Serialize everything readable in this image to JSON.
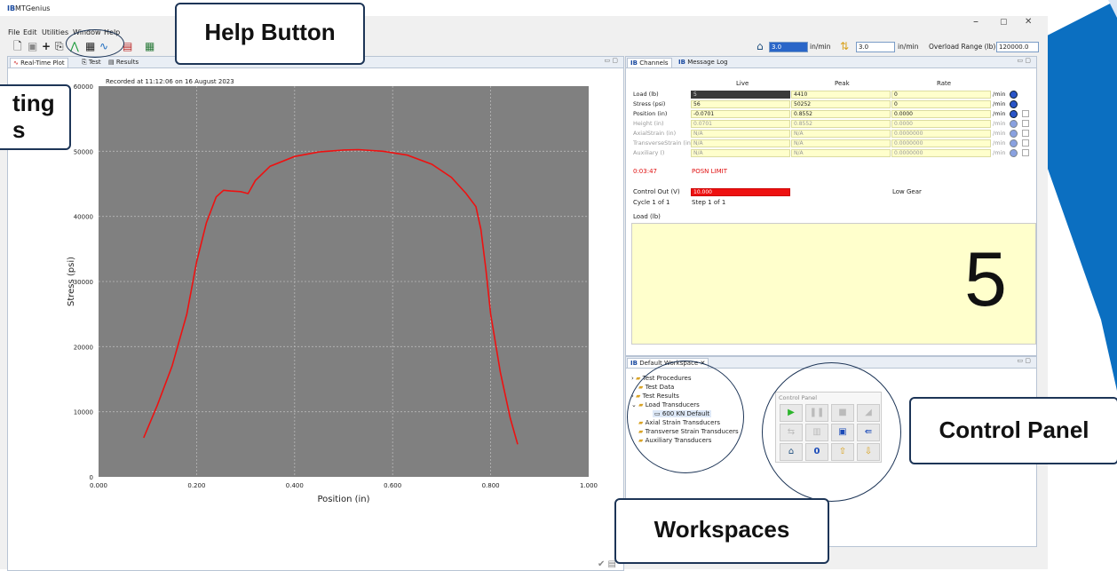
{
  "window": {
    "app_name": "MTGenius",
    "logo": "IB",
    "min_btn": "–",
    "max_btn": "▢",
    "close_btn": "✕"
  },
  "menu": [
    "File",
    "Edit",
    "Utilities",
    "Window",
    "Help"
  ],
  "toolbar": {
    "rate1_value": "3.0",
    "rate1_unit": "in/min",
    "rate2_value": "3.0",
    "rate2_unit": "in/min",
    "overload_label": "Overload Range (lb):",
    "overload_value": "120000.0"
  },
  "left_tabs": [
    "Real-Time Plot",
    "Test",
    "Results"
  ],
  "plot": {
    "recorded": "Recorded at 11:12:06 on 16 August 2023",
    "xlabel": "Position (in)",
    "ylabel": "Stress (psi)",
    "xticks": [
      "0.000",
      "0.200",
      "0.400",
      "0.600",
      "0.800",
      "1.000"
    ],
    "yticks": [
      "0",
      "10000",
      "20000",
      "30000",
      "40000",
      "50000",
      "60000"
    ]
  },
  "chart_data": {
    "type": "line",
    "title": "Recorded at 11:12:06 on 16 August 2023",
    "xlabel": "Position (in)",
    "ylabel": "Stress (psi)",
    "xlim": [
      0,
      1.0
    ],
    "ylim": [
      0,
      60000
    ],
    "grid": true,
    "series": [
      {
        "color": "#ee1111",
        "x": [
          0.092,
          0.12,
          0.15,
          0.18,
          0.2,
          0.22,
          0.24,
          0.255,
          0.27,
          0.29,
          0.305,
          0.32,
          0.35,
          0.4,
          0.45,
          0.5,
          0.53,
          0.58,
          0.63,
          0.68,
          0.72,
          0.75,
          0.77,
          0.78,
          0.79,
          0.8,
          0.82,
          0.84,
          0.855
        ],
        "y": [
          6000,
          11000,
          17000,
          25000,
          33000,
          39000,
          43000,
          44000,
          43900,
          43800,
          43500,
          45500,
          47700,
          49200,
          49900,
          50200,
          50250,
          50000,
          49400,
          48000,
          46000,
          43500,
          41500,
          38000,
          32000,
          25000,
          16000,
          9000,
          5000
        ]
      }
    ]
  },
  "right_tabs": [
    "Channels",
    "Message Log"
  ],
  "channels": {
    "headers": [
      "Live",
      "Peak",
      "Rate"
    ],
    "rows": [
      {
        "name": "Load (lb)",
        "live": "5",
        "peak": "4410",
        "rate": "0",
        "unit": "/min",
        "enabled": true
      },
      {
        "name": "Stress (psi)",
        "live": "56",
        "peak": "50252",
        "rate": "0",
        "unit": "/min",
        "enabled": true
      },
      {
        "name": "Position (in)",
        "live": "-0.0701",
        "peak": "0.8552",
        "rate": "0.0000",
        "unit": "/min",
        "enabled": true
      },
      {
        "name": "Height (in)",
        "live": "0.0701",
        "peak": "0.8552",
        "rate": "0.0000",
        "unit": "/min",
        "enabled": false
      },
      {
        "name": "AxialStrain (in)",
        "live": "N/A",
        "peak": "N/A",
        "rate": "0.0000000",
        "unit": "/min",
        "enabled": false
      },
      {
        "name": "TransverseStrain (in)",
        "live": "N/A",
        "peak": "N/A",
        "rate": "0.0000000",
        "unit": "/min",
        "enabled": false
      },
      {
        "name": "Auxiliary ()",
        "live": "N/A",
        "peak": "N/A",
        "rate": "0.0000000",
        "unit": "/min",
        "enabled": false
      }
    ],
    "time": "0:03:47",
    "limit": "POSN LIMIT",
    "control_out_label": "Control Out (V)",
    "control_out_value": "10.000",
    "gear": "Low Gear",
    "cycle": "Cycle 1 of 1",
    "step": "Step 1 of 1",
    "display_label": "Load (lb)",
    "display_value": "5"
  },
  "workspace": {
    "title": "Default Workspace",
    "items": [
      "Test Procedures",
      "Test Data",
      "Test Results",
      "Load Transducers",
      "600 KN Default",
      "Axial Strain Transducers",
      "Transverse Strain Transducers",
      "Auxiliary Transducers"
    ]
  },
  "control_panel": {
    "title": "Control Panel"
  },
  "callouts": {
    "help": "Help Button",
    "charting_l1": "ting",
    "charting_l2": "s",
    "control": "Control Panel",
    "workspaces": "Workspaces"
  },
  "colors": {
    "accent": "#0b6fc1",
    "curve": "#ee1111",
    "plot_bg": "#808080",
    "cell_bg": "#ffffcc"
  }
}
